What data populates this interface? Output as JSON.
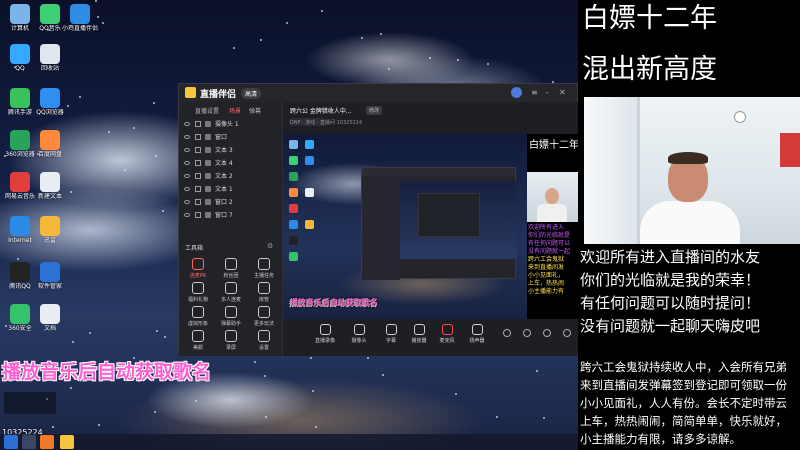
{
  "desktop": {
    "icons": [
      {
        "label": "计算机",
        "color": "#7ab4e8"
      },
      {
        "label": "QQ音乐",
        "color": "#3ccf73"
      },
      {
        "label": "小鸡直播伴侣",
        "color": "#2e8be6"
      },
      {
        "label": "QQ",
        "color": "#34a9ff"
      },
      {
        "label": "回收站",
        "color": "#dfe6ee"
      },
      {
        "label": "腾讯手游",
        "color": "#39c25c"
      },
      {
        "label": "QQ浏览器",
        "color": "#2f8ef0"
      },
      {
        "label": "360浏览器",
        "color": "#29a35a"
      },
      {
        "label": "百度网盘",
        "color": "#ff8a3d"
      },
      {
        "label": "网易云音乐",
        "color": "#e23d3d"
      },
      {
        "label": "新建文本",
        "color": "#e9eef5"
      },
      {
        "label": "Internet",
        "color": "#2a8ae6"
      },
      {
        "label": "迅雷",
        "color": "#f5b83a"
      },
      {
        "label": "腾讯QQ",
        "color": "#222"
      },
      {
        "label": "软件管家",
        "color": "#2c71d6"
      },
      {
        "label": "360安全",
        "color": "#35c26a"
      },
      {
        "label": "文档",
        "color": "#e9eef5"
      }
    ],
    "id_label": "10325224"
  },
  "app": {
    "name": "直播伴侣",
    "badge": "高清",
    "tabs": [
      "直播设置",
      "场景",
      "弹幕"
    ],
    "active_tab": 1,
    "scenes": [
      {
        "name": "摄像头 1"
      },
      {
        "name": "窗口"
      },
      {
        "name": "文本 3"
      },
      {
        "name": "文本 4"
      },
      {
        "name": "文本 2"
      },
      {
        "name": "文本 1"
      },
      {
        "name": "窗口 2"
      },
      {
        "name": "窗口 7"
      }
    ],
    "tools_label": "工具箱",
    "tools": [
      {
        "label": "连麦PK",
        "hot": true
      },
      {
        "label": "粉丝团"
      },
      {
        "label": "主播任务"
      },
      {
        "label": "福利礼物"
      },
      {
        "label": "多人连麦"
      },
      {
        "label": "房管"
      },
      {
        "label": "虚拟形象"
      },
      {
        "label": "弹幕助手"
      },
      {
        "label": "更多玩法"
      },
      {
        "label": "美颜"
      },
      {
        "label": "录屏"
      },
      {
        "label": "设置"
      }
    ],
    "stream_title": "跨六公 金牌猎收人中...",
    "edit_label": "修改",
    "meta": "DNF · 游戏 · 直播间 10325224",
    "bottom_buttons": [
      {
        "label": "直播录像"
      },
      {
        "label": "摄像头"
      },
      {
        "label": "字幕"
      },
      {
        "label": "播放器"
      },
      {
        "label": "麦克风",
        "mic": true
      },
      {
        "label": "扬声器"
      }
    ],
    "preview_chat": [
      "欢迎所有进入",
      "你们的光临就是",
      "有任何问题可以",
      "没有问题就一起",
      "跨六工会鬼狱",
      "来到直播间发",
      "小小见面礼，",
      "上车，热热闹",
      "小主播能力有"
    ],
    "preview_title": "白嫖十二年混出新"
  },
  "banner": "播放音乐后自动获取歌名",
  "overlay": {
    "title_line1": "白嫖十二年",
    "title_line2": "混出新高度",
    "chat": [
      "欢迎所有进入直播间的水友",
      "你们的光临就是我的荣幸！",
      "有任何问题可以随时提问！",
      "没有问题就一起聊天嗨皮吧"
    ],
    "notice": "跨六工会鬼狱持续收人中，入会所有兄弟来到直播间发弹幕签到登记即可领取一份小小见面礼，人人有份。会长不定时带云上车，热热闹闹，简简单单，快乐就好，小主播能力有限，请多多谅解。"
  }
}
